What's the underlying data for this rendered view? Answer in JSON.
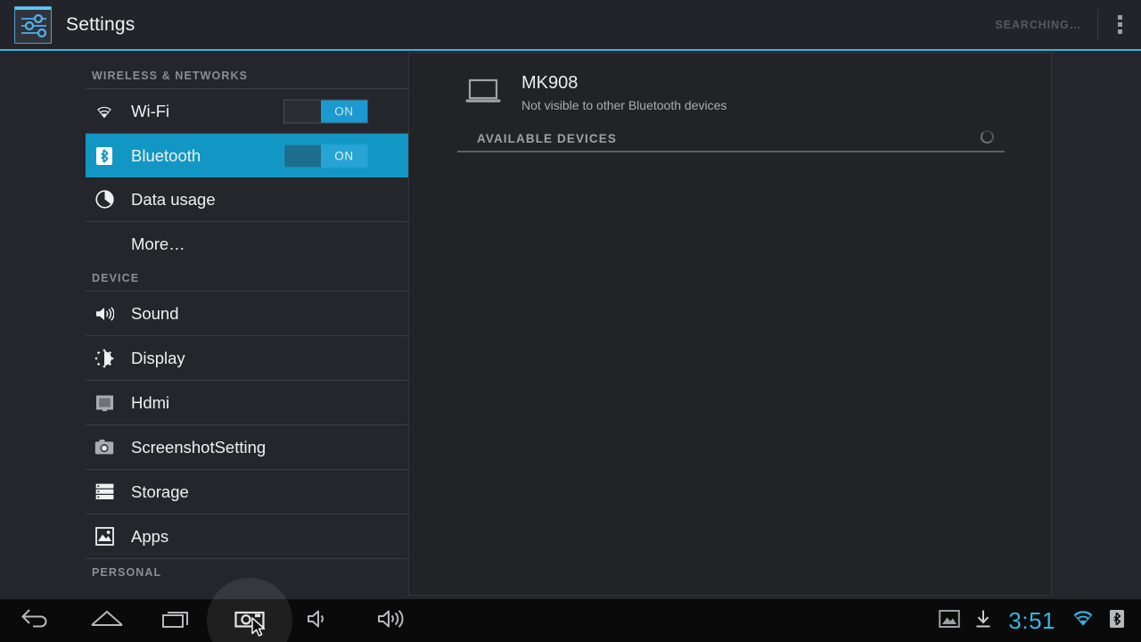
{
  "header": {
    "app_icon": "settings-sliders-icon",
    "title": "Settings",
    "status_label": "SEARCHING…",
    "overflow_menu": "overflow-menu",
    "accent_color": "#33b5e5"
  },
  "sidebar": {
    "sections": [
      {
        "header": "WIRELESS & NETWORKS",
        "items": [
          {
            "label": "Wi-Fi",
            "icon": "wifi-icon",
            "toggle": "ON",
            "selected": false
          },
          {
            "label": "Bluetooth",
            "icon": "bluetooth-icon",
            "toggle": "ON",
            "selected": true
          },
          {
            "label": "Data usage",
            "icon": "data-usage-icon",
            "toggle": null,
            "selected": false
          },
          {
            "label": "More…",
            "icon": null,
            "toggle": null,
            "selected": false
          }
        ]
      },
      {
        "header": "DEVICE",
        "items": [
          {
            "label": "Sound",
            "icon": "sound-icon",
            "toggle": null,
            "selected": false
          },
          {
            "label": "Display",
            "icon": "display-icon",
            "toggle": null,
            "selected": false
          },
          {
            "label": "Hdmi",
            "icon": "hdmi-icon",
            "toggle": null,
            "selected": false
          },
          {
            "label": "ScreenshotSetting",
            "icon": "camera-icon",
            "toggle": null,
            "selected": false
          },
          {
            "label": "Storage",
            "icon": "storage-icon",
            "toggle": null,
            "selected": false
          },
          {
            "label": "Apps",
            "icon": "apps-icon",
            "toggle": null,
            "selected": false
          }
        ]
      },
      {
        "header": "PERSONAL",
        "items": []
      }
    ],
    "selected_color": "#1297c4"
  },
  "content": {
    "device": {
      "icon": "laptop-icon",
      "name": "MK908",
      "visibility": "Not visible to other Bluetooth devices"
    },
    "available_devices_header": "AVAILABLE DEVICES",
    "scanning_spinner": "loading-spinner"
  },
  "navbar": {
    "buttons": [
      {
        "name": "back-icon",
        "pressed": false
      },
      {
        "name": "home-icon",
        "pressed": false
      },
      {
        "name": "recents-icon",
        "pressed": false
      },
      {
        "name": "screenshot-icon",
        "pressed": true
      },
      {
        "name": "volume-down-icon",
        "pressed": false
      },
      {
        "name": "volume-up-icon",
        "pressed": false
      }
    ],
    "status": {
      "screenshot_notification": "image-icon",
      "download_icon": "download-icon",
      "clock": "3:51",
      "wifi_icon": "wifi-status-icon",
      "bluetooth_icon": "bluetooth-status-icon",
      "clock_color": "#33b5e5"
    }
  }
}
